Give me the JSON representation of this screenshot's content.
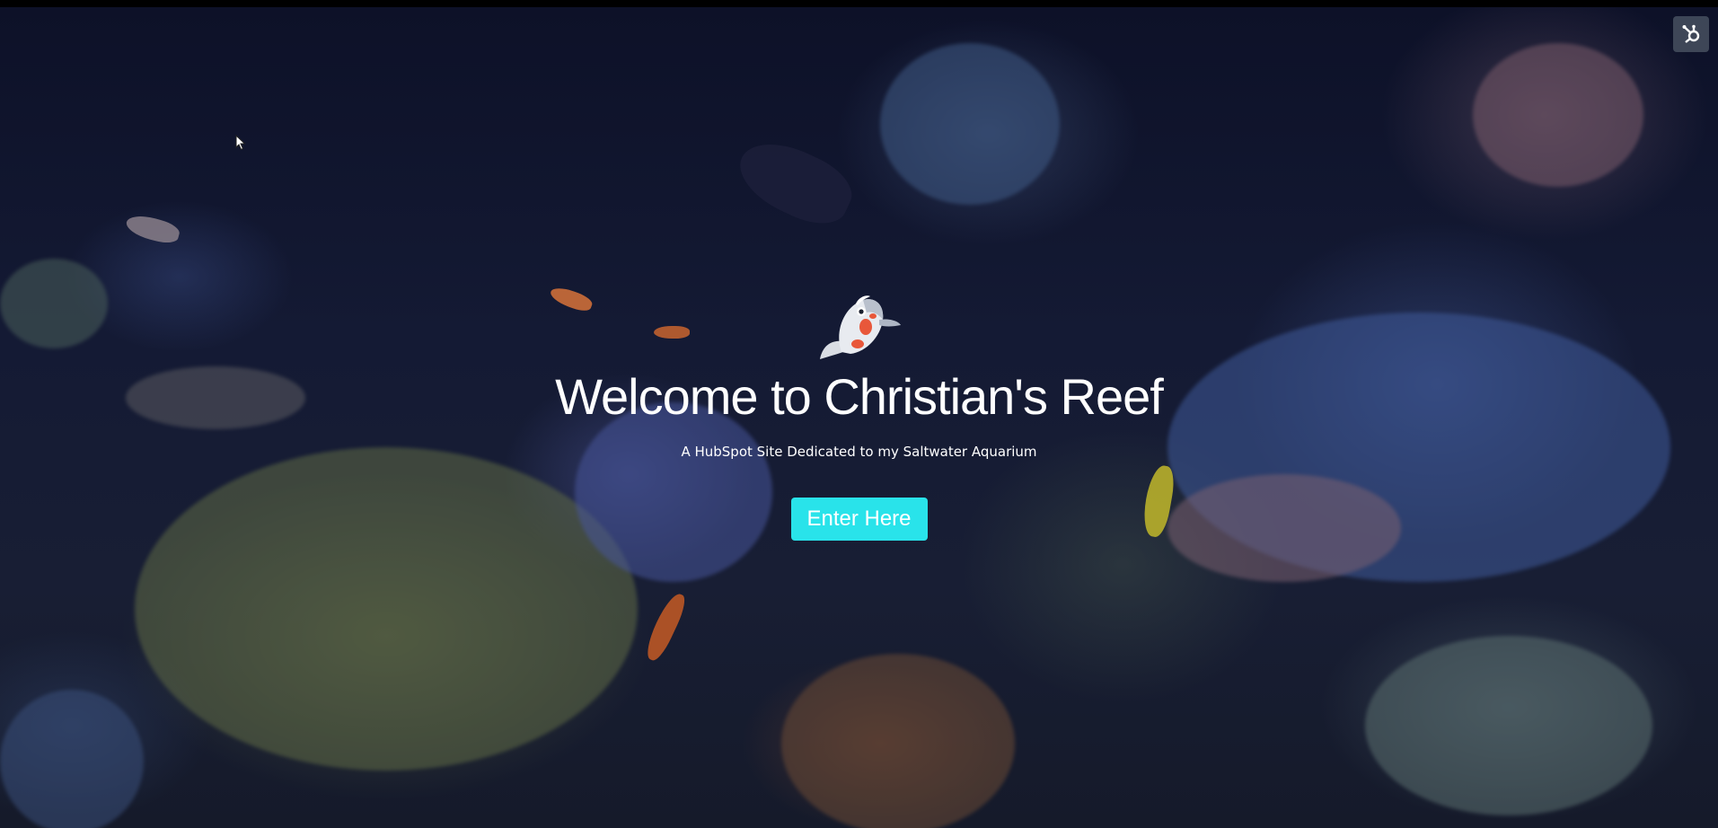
{
  "hero": {
    "title": "Welcome to Christian's Reef",
    "subtitle": "A HubSpot Site Dedicated to my Saltwater Aquarium",
    "button_label": "Enter Here"
  },
  "badge": {
    "icon": "hubspot-sprocket-icon"
  },
  "logo": {
    "icon": "koi-fish-logo-icon"
  },
  "colors": {
    "accent": "#29e3ea",
    "background": "#0b0f22",
    "text": "#ffffff"
  }
}
